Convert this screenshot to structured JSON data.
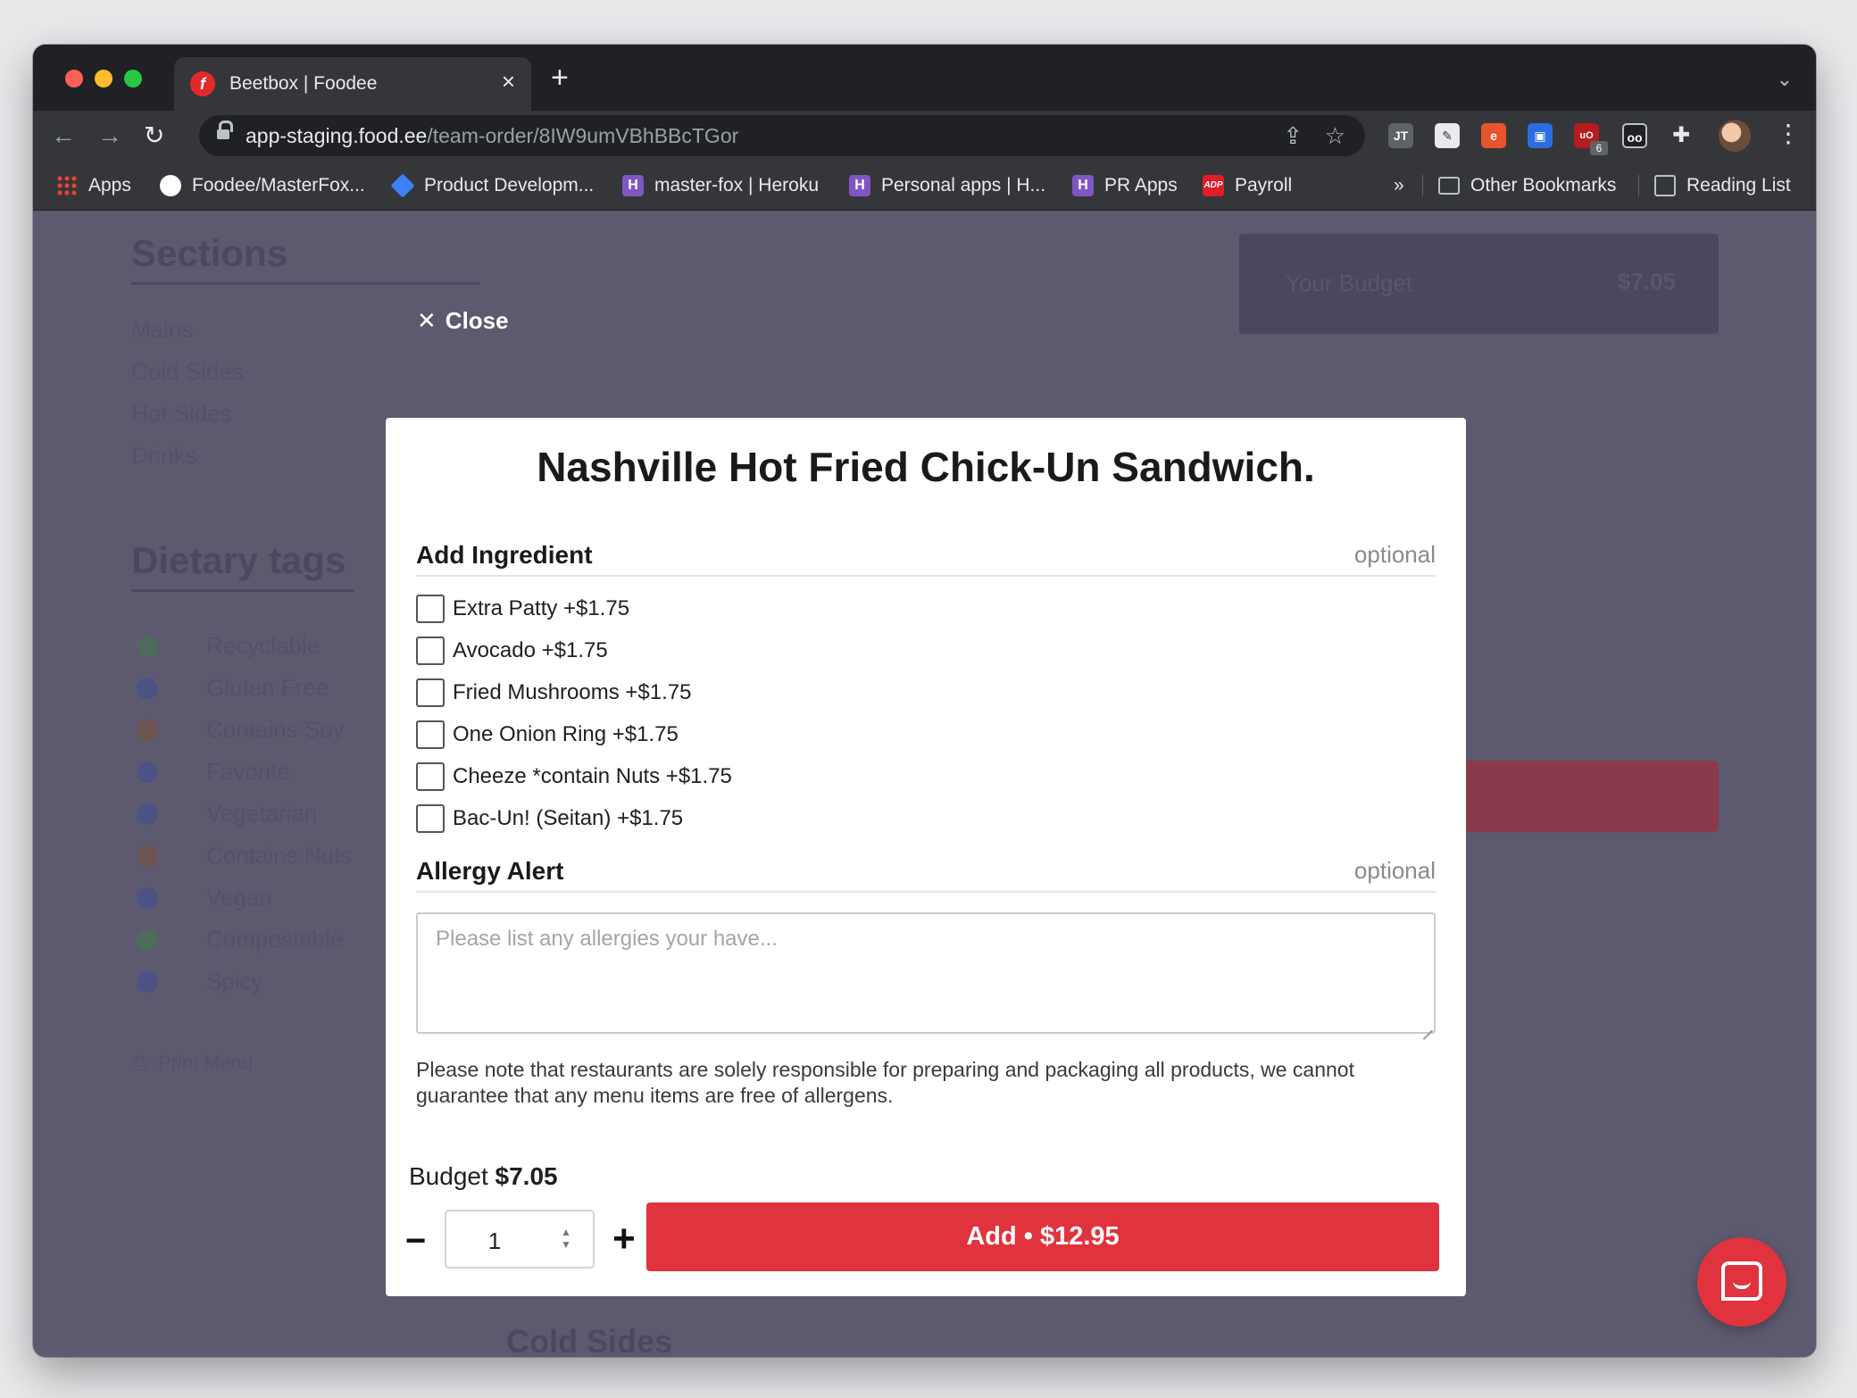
{
  "browser": {
    "tab_title": "Beetbox | Foodee",
    "url_host": "app-staging.food.ee",
    "url_path": "/team-order/8IW9umVBhBBcTGor",
    "extension_badge": "6",
    "bookmarks": [
      {
        "label": "Apps",
        "icon": "apps-grid-icon"
      },
      {
        "label": "Foodee/MasterFox...",
        "icon": "github-icon"
      },
      {
        "label": "Product Developm...",
        "icon": "diamond-icon"
      },
      {
        "label": "master-fox | Heroku",
        "icon": "heroku-icon"
      },
      {
        "label": "Personal apps | H...",
        "icon": "heroku-icon"
      },
      {
        "label": "PR Apps",
        "icon": "heroku-icon"
      },
      {
        "label": "Payroll",
        "icon": "adp-icon"
      }
    ],
    "overflow_label": "»",
    "other_bookmarks": "Other Bookmarks",
    "reading_list": "Reading List"
  },
  "background": {
    "sections_heading": "Sections",
    "sections": [
      "Mains",
      "Cold Sides",
      "Hot Sides",
      "Drinks"
    ],
    "dietary_heading": "Dietary tags",
    "dietary": [
      "Recyclable",
      "Gluten Free",
      "Contains Soy",
      "Favorite",
      "Vegetarian",
      "Contains Nuts",
      "Vegan",
      "Compostable",
      "Spicy"
    ],
    "print_menu": "Print Menu",
    "budget_label": "Your Budget",
    "budget_value": "$7.05",
    "cold_sides_heading": "Cold Sides"
  },
  "modal": {
    "close_label": "Close",
    "title": "Nashville Hot Fried Chick-Un Sandwich.",
    "add_ingredient": {
      "title": "Add Ingredient",
      "optional": "optional",
      "options": [
        "Extra Patty +$1.75",
        "Avocado +$1.75",
        "Fried Mushrooms +$1.75",
        "One Onion Ring +$1.75",
        "Cheeze *contain Nuts +$1.75",
        "Bac-Un! (Seitan) +$1.75"
      ]
    },
    "allergy": {
      "title": "Allergy Alert",
      "optional": "optional",
      "placeholder": "Please list any allergies your have..."
    },
    "note": "Please note that restaurants are solely responsible for preparing and packaging all products, we cannot guarantee that any menu items are free of allergens.",
    "budget_label": "Budget",
    "budget_value": "$7.05",
    "quantity": "1",
    "minus": "−",
    "plus": "+",
    "add_button": "Add • $12.95"
  },
  "colors": {
    "accent_red": "#e1333d",
    "overlay": "#5d596f"
  }
}
